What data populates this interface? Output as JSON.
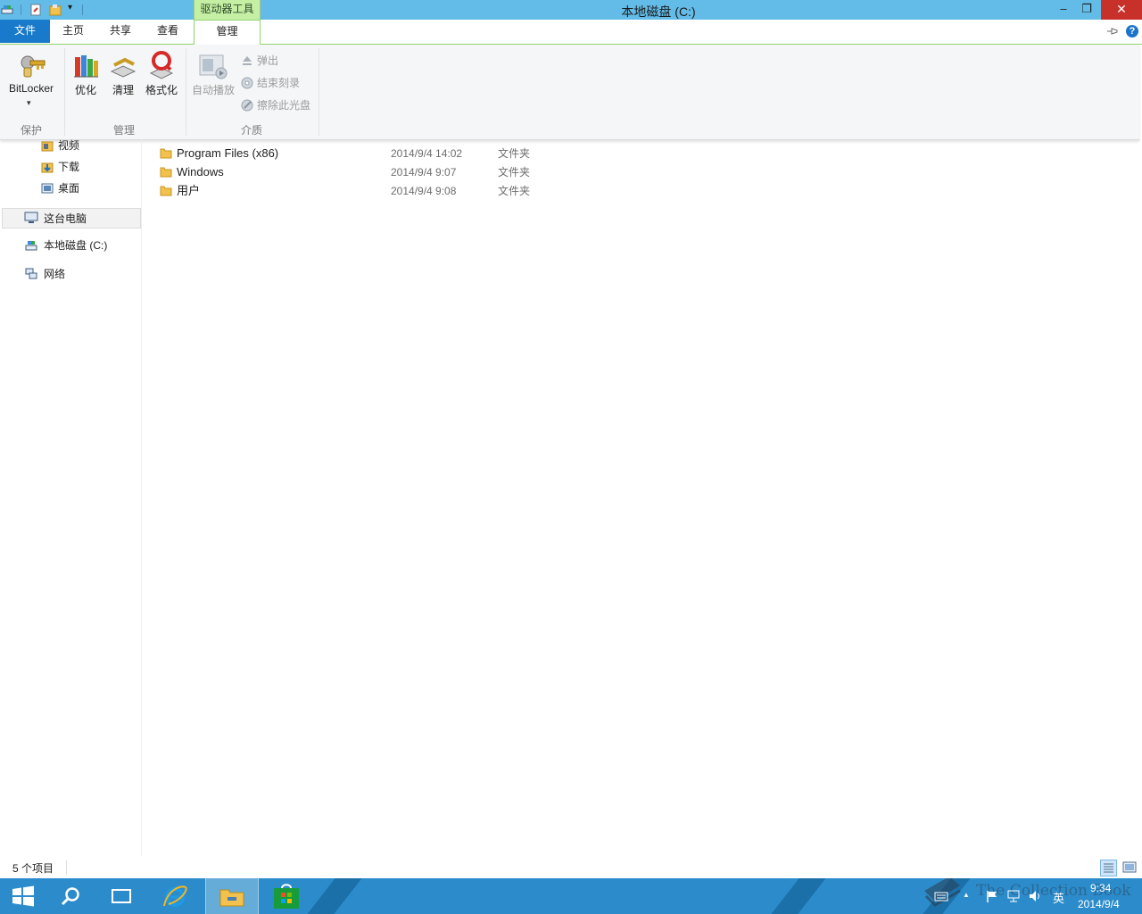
{
  "window": {
    "title": "本地磁盘 (C:)",
    "context_tool_group": "驱动器工具",
    "minimize_glyph": "–",
    "restore_glyph": "❐",
    "close_glyph": "✕"
  },
  "tabs": {
    "file": "文件",
    "home": "主页",
    "share": "共享",
    "view": "查看",
    "manage": "管理"
  },
  "ribbon": {
    "protect": {
      "label": "保护",
      "bitlocker": "BitLocker",
      "dropdown": "▾"
    },
    "manage": {
      "label": "管理",
      "optimize": "优化",
      "cleanup": "清理",
      "format": "格式化"
    },
    "media": {
      "label": "介质",
      "autoplay": "自动播放",
      "eject": "弹出",
      "finish_burning": "结束刻录",
      "erase_disc": "擦除此光盘"
    }
  },
  "nav": {
    "videos": "视频",
    "downloads": "下载",
    "desktop": "桌面",
    "this_pc": "这台电脑",
    "local_disk": "本地磁盘 (C:)",
    "network": "网络"
  },
  "files": [
    {
      "name": "Program Files (x86)",
      "date": "2014/9/4 14:02",
      "type": "文件夹"
    },
    {
      "name": "Windows",
      "date": "2014/9/4 9:07",
      "type": "文件夹"
    },
    {
      "name": "用户",
      "date": "2014/9/4 9:08",
      "type": "文件夹"
    }
  ],
  "status": {
    "item_count": "5 个项目"
  },
  "taskbar": {
    "time": "9:34",
    "date": "2014/9/4",
    "ime": "英",
    "tray_up": "▲",
    "watermark": "The Collection Book"
  },
  "colors": {
    "title_bar": "#63bce8",
    "file_tab": "#1979ca",
    "context_tab": "#c5f0a4",
    "close_button": "#c7312a",
    "taskbar": "#2c8ccb"
  }
}
